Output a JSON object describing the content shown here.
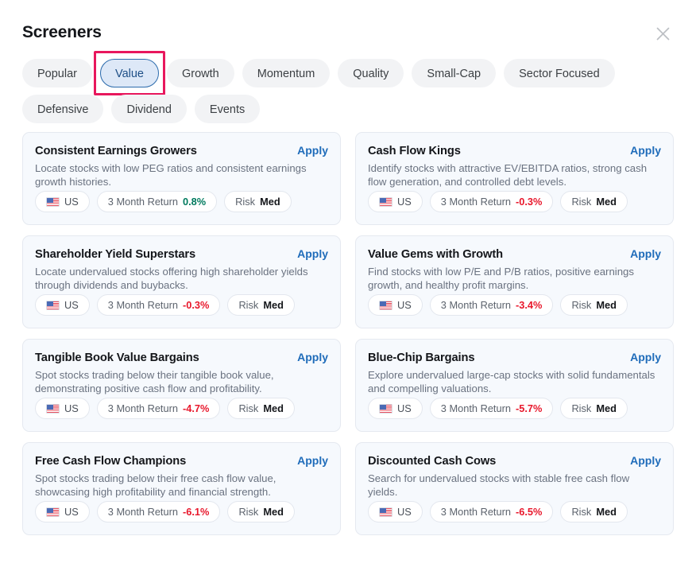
{
  "header": {
    "title": "Screeners",
    "close_icon": "close-icon"
  },
  "tabs": [
    {
      "label": "Popular",
      "active": false,
      "annotated": false
    },
    {
      "label": "Value",
      "active": true,
      "annotated": true
    },
    {
      "label": "Growth",
      "active": false,
      "annotated": false
    },
    {
      "label": "Momentum",
      "active": false,
      "annotated": false
    },
    {
      "label": "Quality",
      "active": false,
      "annotated": false
    },
    {
      "label": "Small-Cap",
      "active": false,
      "annotated": false
    },
    {
      "label": "Sector Focused",
      "active": false,
      "annotated": false
    },
    {
      "label": "Defensive",
      "active": false,
      "annotated": false
    },
    {
      "label": "Dividend",
      "active": false,
      "annotated": false
    },
    {
      "label": "Events",
      "active": false,
      "annotated": false
    }
  ],
  "labels": {
    "apply": "Apply",
    "return_label": "3 Month Return",
    "risk_label": "Risk",
    "region": "US"
  },
  "colors": {
    "accent_blue": "#1f6cba",
    "positive_green": "#007a5e",
    "negative_red": "#e8182c",
    "annotation_pink": "#e8175d",
    "active_tab_border": "#2d6cad",
    "card_background": "#f6f9fd"
  },
  "cards": [
    {
      "title": "Consistent Earnings Growers",
      "apply": "Apply",
      "description": "Locate stocks with low PEG ratios and consistent earnings growth histories.",
      "region": "US",
      "return_label": "3 Month Return",
      "return_value": "0.8%",
      "return_sign": "positive",
      "risk_label": "Risk",
      "risk_value": "Med"
    },
    {
      "title": "Cash Flow Kings",
      "apply": "Apply",
      "description": "Identify stocks with attractive EV/EBITDA ratios, strong cash flow generation, and controlled debt levels.",
      "region": "US",
      "return_label": "3 Month Return",
      "return_value": "-0.3%",
      "return_sign": "negative",
      "risk_label": "Risk",
      "risk_value": "Med"
    },
    {
      "title": "Shareholder Yield Superstars",
      "apply": "Apply",
      "description": "Locate undervalued stocks offering high shareholder yields through dividends and buybacks.",
      "region": "US",
      "return_label": "3 Month Return",
      "return_value": "-0.3%",
      "return_sign": "negative",
      "risk_label": "Risk",
      "risk_value": "Med"
    },
    {
      "title": "Value Gems with Growth",
      "apply": "Apply",
      "description": "Find stocks with low P/E and P/B ratios, positive earnings growth, and healthy profit margins.",
      "region": "US",
      "return_label": "3 Month Return",
      "return_value": "-3.4%",
      "return_sign": "negative",
      "risk_label": "Risk",
      "risk_value": "Med"
    },
    {
      "title": "Tangible Book Value Bargains",
      "apply": "Apply",
      "description": "Spot stocks trading below their tangible book value, demonstrating positive cash flow and profitability.",
      "region": "US",
      "return_label": "3 Month Return",
      "return_value": "-4.7%",
      "return_sign": "negative",
      "risk_label": "Risk",
      "risk_value": "Med"
    },
    {
      "title": "Blue-Chip Bargains",
      "apply": "Apply",
      "description": "Explore undervalued large-cap stocks with solid fundamentals and compelling valuations.",
      "region": "US",
      "return_label": "3 Month Return",
      "return_value": "-5.7%",
      "return_sign": "negative",
      "risk_label": "Risk",
      "risk_value": "Med"
    },
    {
      "title": "Free Cash Flow Champions",
      "apply": "Apply",
      "description": "Spot stocks trading below their free cash flow value, showcasing high profitability and financial strength.",
      "region": "US",
      "return_label": "3 Month Return",
      "return_value": "-6.1%",
      "return_sign": "negative",
      "risk_label": "Risk",
      "risk_value": "Med"
    },
    {
      "title": "Discounted Cash Cows",
      "apply": "Apply",
      "description": "Search for undervalued stocks with stable free cash flow yields.",
      "region": "US",
      "return_label": "3 Month Return",
      "return_value": "-6.5%",
      "return_sign": "negative",
      "risk_label": "Risk",
      "risk_value": "Med"
    }
  ]
}
